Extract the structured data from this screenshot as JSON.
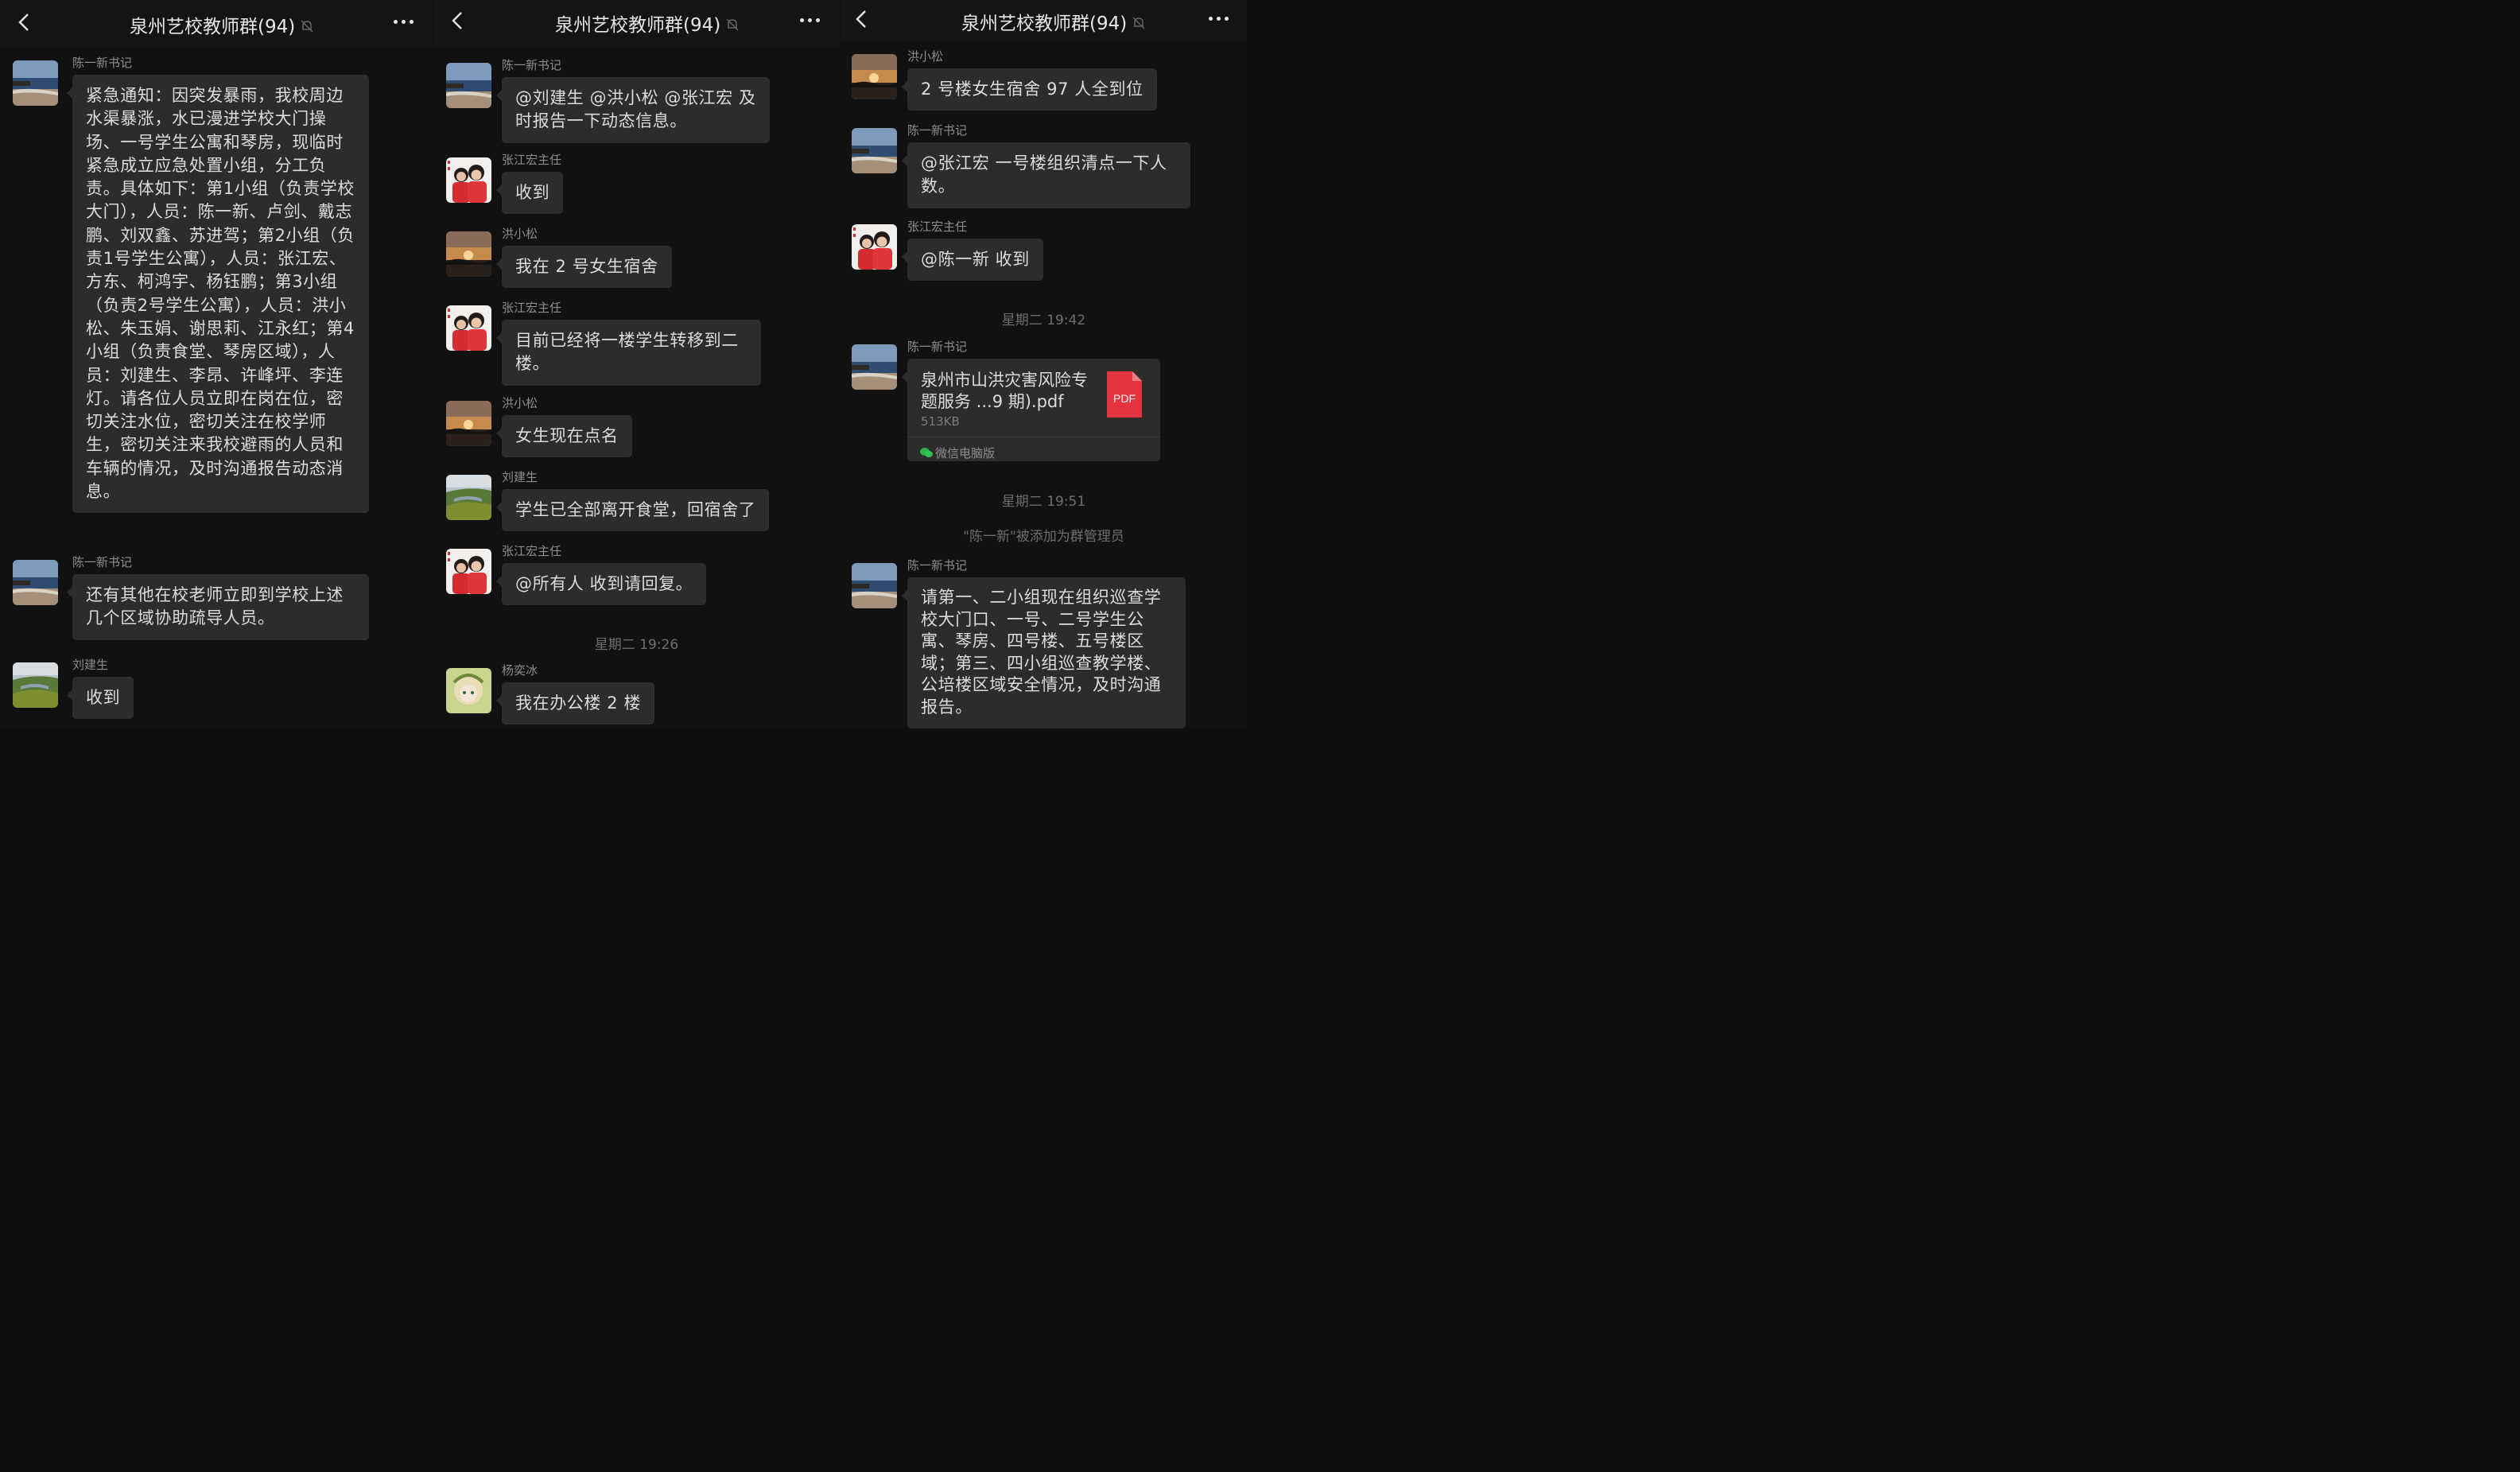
{
  "chat": {
    "title": "泉州艺校教师群(94)"
  },
  "panel1": {
    "messages": [
      {
        "sender": "陈一新书记",
        "text": "紧急通知：因突发暴雨，我校周边水渠暴涨，水已漫进学校大门操场、一号学生公寓和琴房，现临时紧急成立应急处置小组，分工负责。具体如下：第1小组（负责学校大门），人员：陈一新、卢剑、戴志鹏、刘双鑫、苏进驾；第2小组（负责1号学生公寓），人员：张江宏、方东、柯鸿宇、杨钰鹏；第3小组（负责2号学生公寓），人员：洪小松、朱玉娟、谢思莉、江永红；第4小组（负责食堂、琴房区域），人员：刘建生、李昂、许峰坪、李连灯。请各位人员立即在岗在位，密切关注水位，密切关注在校学师生，密切关注来我校避雨的人员和车辆的情况，及时沟通报告动态消息。"
      },
      {
        "sender": "陈一新书记",
        "text": "还有其他在校老师立即到学校上述几个区域协助疏导人员。"
      },
      {
        "sender": "刘建生",
        "text": "收到"
      }
    ]
  },
  "panel2": {
    "messages": [
      {
        "sender": "陈一新书记",
        "text": "@刘建生 @洪小松 @张江宏 及时报告一下动态信息。"
      },
      {
        "sender": "张江宏主任",
        "text": "收到"
      },
      {
        "sender": "洪小松",
        "text": "我在 2 号女生宿舍"
      },
      {
        "sender": "张江宏主任",
        "text": "目前已经将一楼学生转移到二楼。"
      },
      {
        "sender": "洪小松",
        "text": "女生现在点名"
      },
      {
        "sender": "刘建生",
        "text": "学生已全部离开食堂，回宿舍了"
      },
      {
        "sender": "张江宏主任",
        "text": "@所有人 收到请回复。"
      },
      {
        "sender": "杨奕冰",
        "text": "我在办公楼 2 楼"
      }
    ],
    "time1": "星期二 19:26"
  },
  "panel3": {
    "messages": [
      {
        "sender": "洪小松",
        "text": "2 号楼女生宿舍 97 人全到位"
      },
      {
        "sender": "陈一新书记",
        "text": "@张江宏 一号楼组织清点一下人数。"
      },
      {
        "sender": "张江宏主任",
        "text": "@陈一新 收到"
      },
      {
        "sender": "陈一新书记",
        "text": "请第一、二小组现在组织巡查学校大门口、一号、二号学生公寓、琴房、四号楼、五号楼区域；第三、四小组巡查教学楼、公培楼区域安全情况，及时沟通报告。"
      }
    ],
    "file": {
      "sender": "陈一新书记",
      "name": "泉州市山洪灾害风险专题服务 ...9 期).pdf",
      "size": "513KB",
      "source": "微信电脑版",
      "badge": "PDF"
    },
    "time1": "星期二 19:42",
    "time2": "星期二 19:51",
    "system": "\"陈一新\"被添加为群管理员"
  },
  "colors": {
    "background": "#111111",
    "bubble": "#2c2c2c",
    "text": "#dcdcdc",
    "pdf": "#e5343f"
  },
  "icons": [
    "back-arrow-icon",
    "mute-bell-icon",
    "more-dots-icon",
    "pdf-icon",
    "wechat-icon"
  ]
}
